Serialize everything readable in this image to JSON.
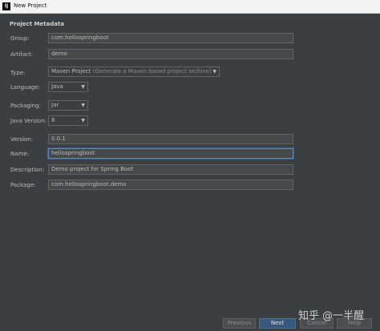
{
  "window": {
    "title": "New Project",
    "app_icon": "IJ"
  },
  "section": {
    "title": "Project Metadata"
  },
  "form": {
    "group": {
      "label": "Group:",
      "value": "com.hellospringboot"
    },
    "artifact": {
      "label": "Artifact:",
      "value": "demo"
    },
    "type": {
      "label": "Type:",
      "value": "Maven Project",
      "hint": "(Generate a Maven based project archive)"
    },
    "language": {
      "label": "Language:",
      "value": "Java"
    },
    "packaging": {
      "label": "Packaging:",
      "value": "Jar"
    },
    "java_version": {
      "label": "Java Version:",
      "value": "8"
    },
    "version": {
      "label": "Version:",
      "value": "0.0.1"
    },
    "name": {
      "label": "Name:",
      "value": "hellospringboot"
    },
    "description": {
      "label": "Description:",
      "value": "Demo project for Spring Boot"
    },
    "package": {
      "label": "Package:",
      "value": "com.hellospringboot.demo"
    }
  },
  "buttons": {
    "previous": "Previous",
    "next": "Next",
    "cancel": "Cancel",
    "help": "Help"
  },
  "watermark": "知乎 @一半醒",
  "colors": {
    "background": "#3c3f41",
    "field_bg": "#45494a",
    "focus_border": "#5a88c2",
    "primary_button": "#365880"
  }
}
